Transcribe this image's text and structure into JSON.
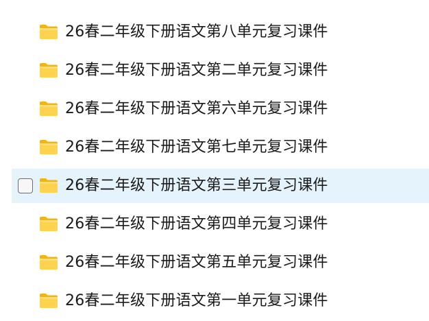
{
  "files": [
    {
      "name": "26春二年级下册语文第八单元复习课件",
      "icon": "folder-icon",
      "hovered": false
    },
    {
      "name": "26春二年级下册语文第二单元复习课件",
      "icon": "folder-icon",
      "hovered": false
    },
    {
      "name": "26春二年级下册语文第六单元复习课件",
      "icon": "folder-icon",
      "hovered": false
    },
    {
      "name": "26春二年级下册语文第七单元复习课件",
      "icon": "folder-icon",
      "hovered": false
    },
    {
      "name": "26春二年级下册语文第三单元复习课件",
      "icon": "folder-icon",
      "hovered": true
    },
    {
      "name": "26春二年级下册语文第四单元复习课件",
      "icon": "folder-icon",
      "hovered": false
    },
    {
      "name": "26春二年级下册语文第五单元复习课件",
      "icon": "folder-icon",
      "hovered": false
    },
    {
      "name": "26春二年级下册语文第一单元复习课件",
      "icon": "folder-icon",
      "hovered": false
    }
  ],
  "colors": {
    "hover_background": "#e5f3fd",
    "folder_back": "#f2b81d",
    "folder_front": "#ffd454",
    "text": "#1a1a1a"
  }
}
